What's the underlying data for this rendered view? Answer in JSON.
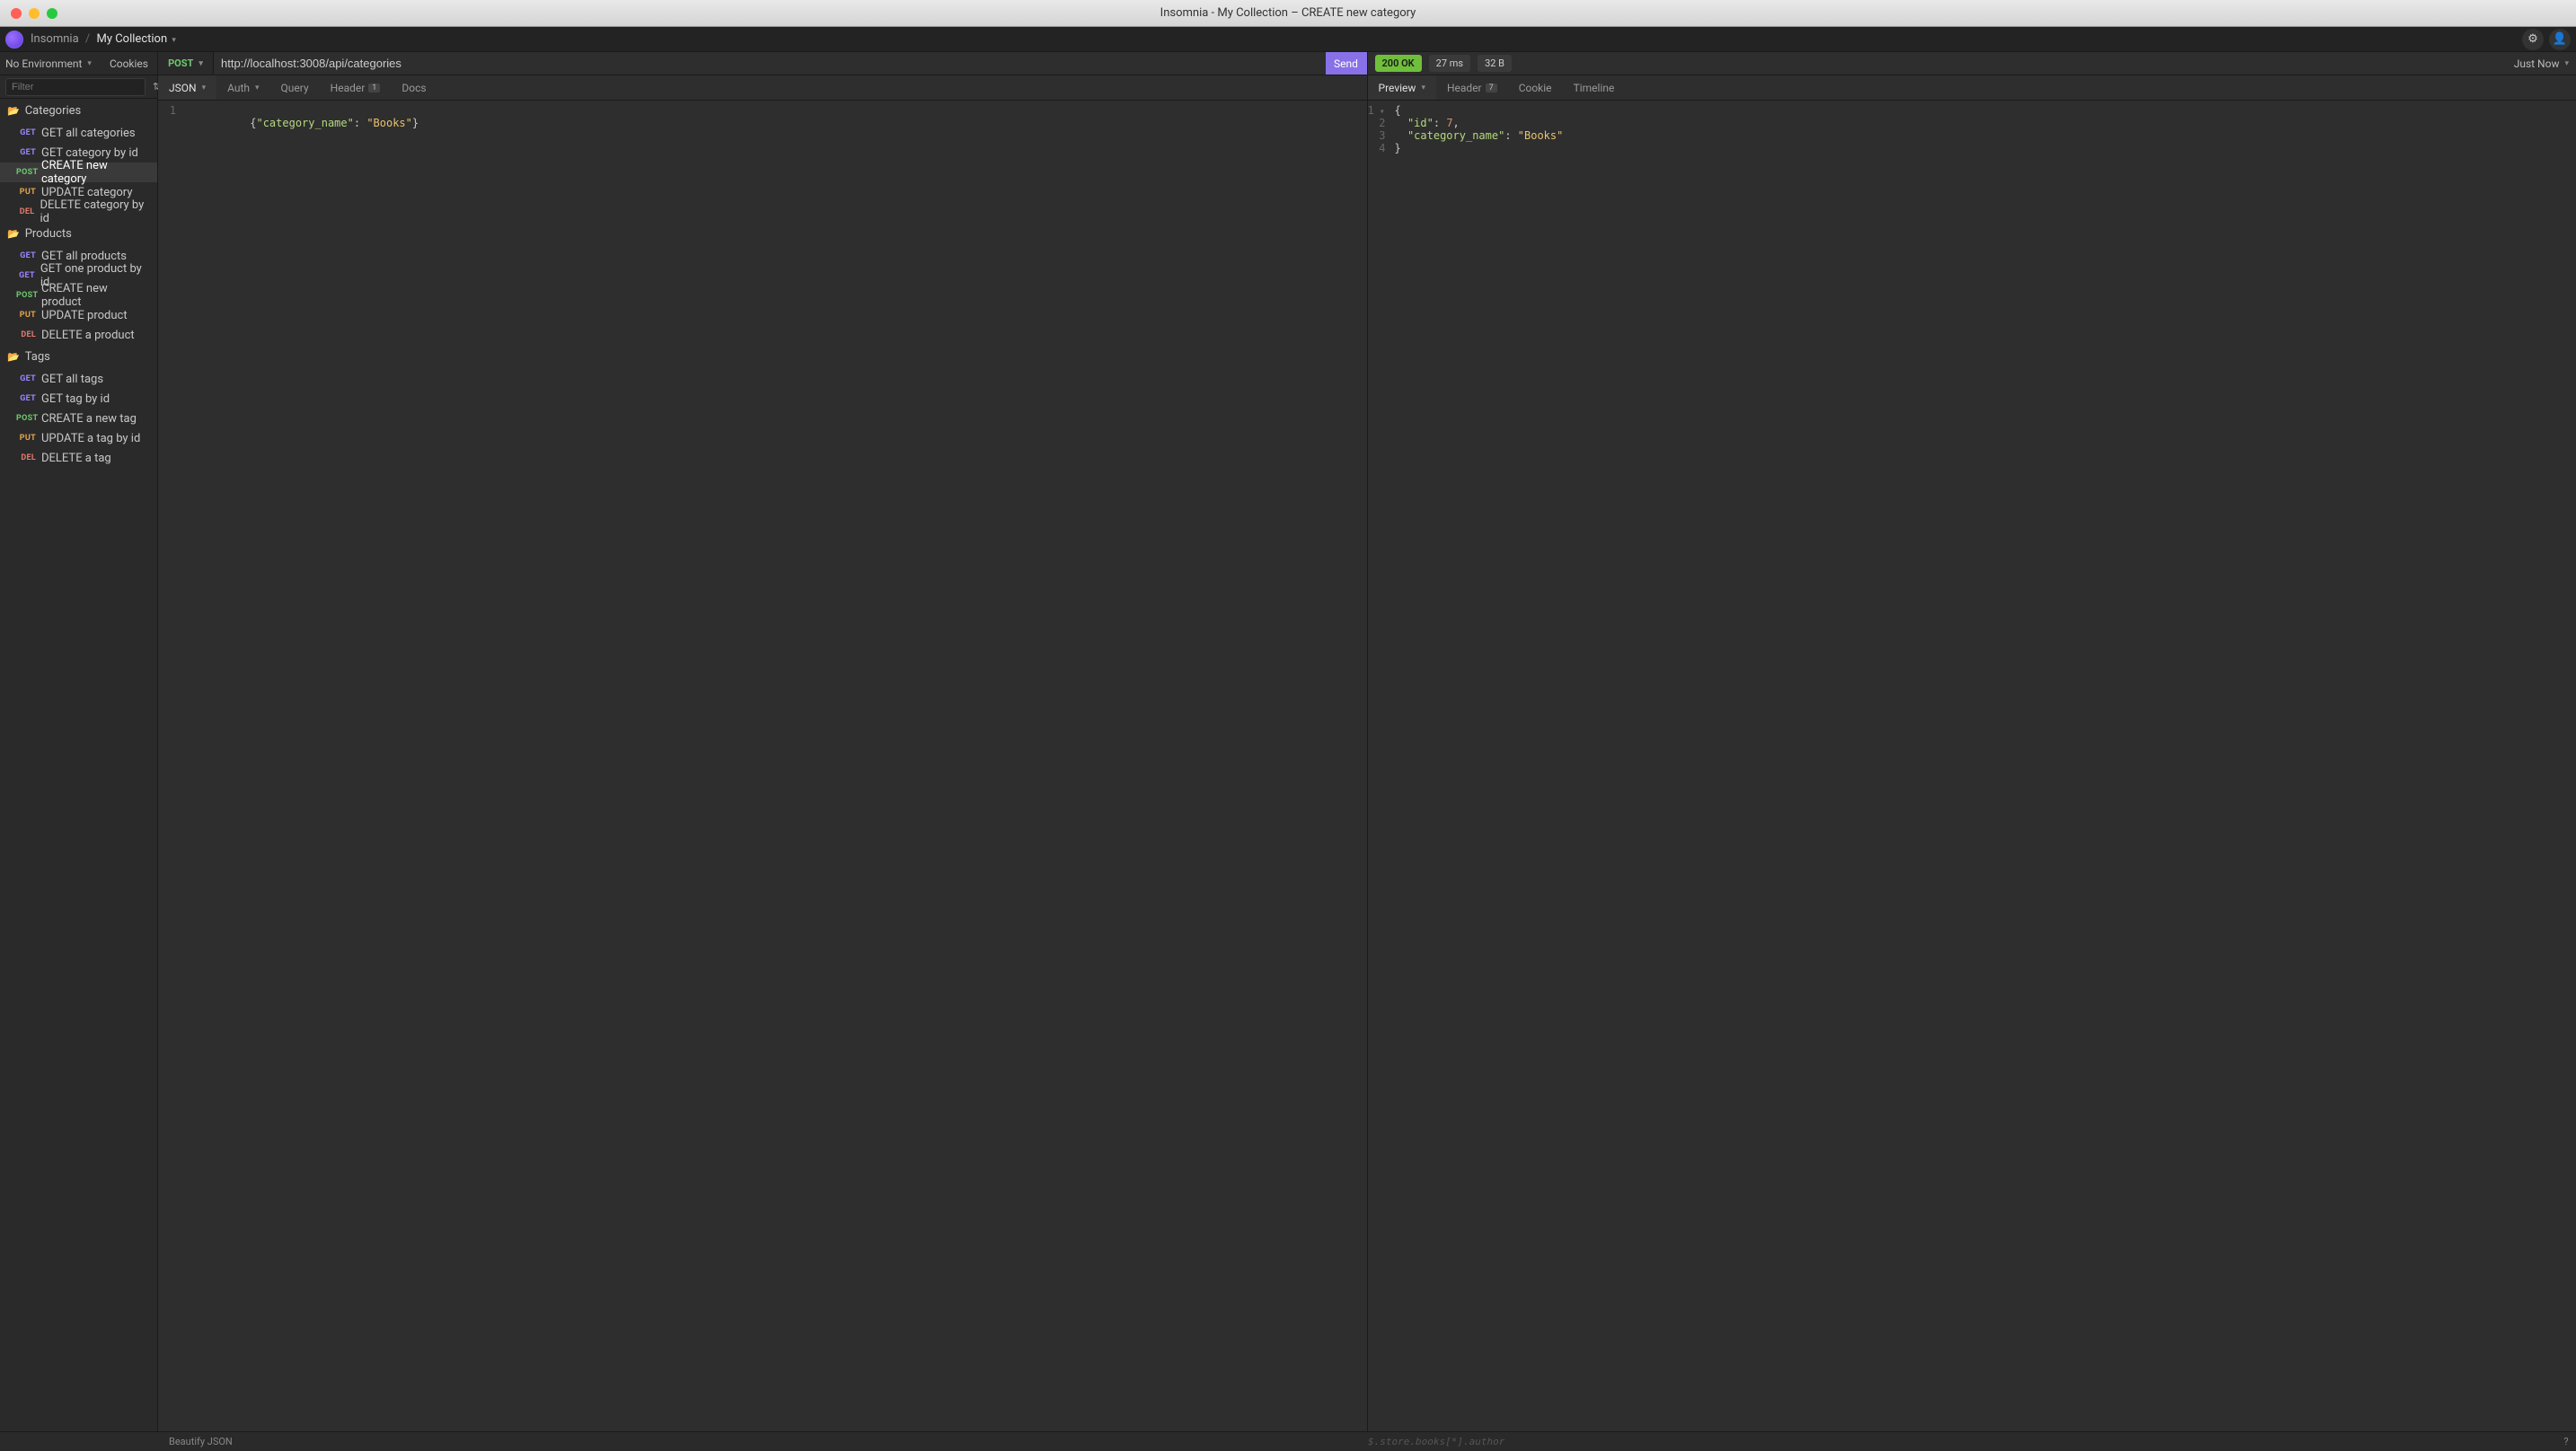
{
  "window": {
    "title": "Insomnia - My Collection – CREATE new category"
  },
  "breadcrumb": {
    "app": "Insomnia",
    "collection": "My Collection"
  },
  "sidebar": {
    "env_label": "No Environment",
    "cookies_label": "Cookies",
    "filter_placeholder": "Filter",
    "folders": [
      {
        "name": "Categories",
        "requests": [
          {
            "method": "GET",
            "label": "GET all categories"
          },
          {
            "method": "GET",
            "label": "GET category by id"
          },
          {
            "method": "POST",
            "label": "CREATE new category",
            "active": true
          },
          {
            "method": "PUT",
            "label": "UPDATE category"
          },
          {
            "method": "DEL",
            "label": "DELETE category by id"
          }
        ]
      },
      {
        "name": "Products",
        "requests": [
          {
            "method": "GET",
            "label": "GET all products"
          },
          {
            "method": "GET",
            "label": "GET one product by id"
          },
          {
            "method": "POST",
            "label": "CREATE new product"
          },
          {
            "method": "PUT",
            "label": "UPDATE product"
          },
          {
            "method": "DEL",
            "label": "DELETE a product"
          }
        ]
      },
      {
        "name": "Tags",
        "requests": [
          {
            "method": "GET",
            "label": "GET all tags"
          },
          {
            "method": "GET",
            "label": "GET tag by id"
          },
          {
            "method": "POST",
            "label": "CREATE a new tag"
          },
          {
            "method": "PUT",
            "label": "UPDATE a tag by id"
          },
          {
            "method": "DEL",
            "label": "DELETE a tag"
          }
        ]
      }
    ]
  },
  "request": {
    "method": "POST",
    "url": "http://localhost:3008/api/categories",
    "send_label": "Send",
    "tabs": {
      "body": "JSON",
      "auth": "Auth",
      "query": "Query",
      "header": "Header",
      "header_count": "1",
      "docs": "Docs"
    },
    "body_json": {
      "line1": {
        "open": "{",
        "key": "\"category_name\"",
        "colon": ": ",
        "val": "\"Books\"",
        "close": "}"
      }
    }
  },
  "response": {
    "status": "200 OK",
    "time": "27 ms",
    "size": "32 B",
    "just_now": "Just Now",
    "tabs": {
      "preview": "Preview",
      "header": "Header",
      "header_count": "7",
      "cookie": "Cookie",
      "timeline": "Timeline"
    },
    "body_lines": {
      "l1": {
        "text": "{"
      },
      "l2": {
        "indent": "  ",
        "key": "\"id\"",
        "colon": ": ",
        "val": "7",
        "comma": ","
      },
      "l3": {
        "indent": "  ",
        "key": "\"category_name\"",
        "colon": ": ",
        "val": "\"Books\""
      },
      "l4": {
        "text": "}"
      }
    }
  },
  "footer": {
    "beautify": "Beautify JSON",
    "jsonpath_placeholder": "$.store.books[*].author"
  }
}
